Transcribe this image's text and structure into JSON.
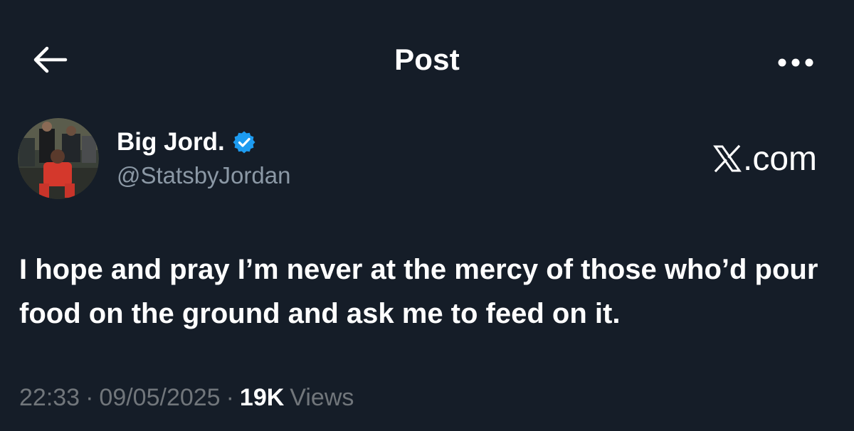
{
  "header": {
    "title": "Post",
    "back_icon": "arrow-left-icon",
    "more_icon": "more-horizontal-icon"
  },
  "author": {
    "name": "Big Jord.",
    "handle": "@StatsbyJordan",
    "verified": true,
    "verified_color": "#1d9bf0",
    "avatar_icon": "user-avatar-photo"
  },
  "source_mark": {
    "logo_icon": "x-logo-icon",
    "text": ".com"
  },
  "post": {
    "text": "I hope and pray I’m never at the mercy of those who’d pour food on the ground and ask me to feed on it."
  },
  "meta": {
    "time": "22:33",
    "separator": "·",
    "date": "09/05/2025",
    "views_count": "19K",
    "views_label": "Views"
  },
  "colors": {
    "background": "#151d28",
    "primary_text": "#ffffff",
    "secondary_text": "#71767b",
    "accent": "#1d9bf0"
  }
}
